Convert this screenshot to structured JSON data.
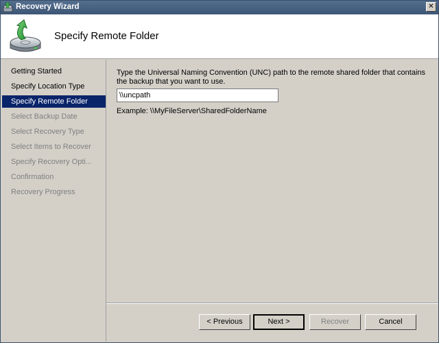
{
  "window": {
    "title": "Recovery Wizard",
    "close_glyph": "✕"
  },
  "header": {
    "heading": "Specify Remote Folder",
    "icon": "backup-recovery-icon"
  },
  "nav": {
    "items": [
      {
        "label": "Getting Started",
        "state": "enabled"
      },
      {
        "label": "Specify Location Type",
        "state": "enabled"
      },
      {
        "label": "Specify Remote Folder",
        "state": "selected"
      },
      {
        "label": "Select Backup Date",
        "state": "disabled"
      },
      {
        "label": "Select Recovery Type",
        "state": "disabled"
      },
      {
        "label": "Select Items to Recover",
        "state": "disabled"
      },
      {
        "label": "Specify Recovery Opti...",
        "state": "disabled"
      },
      {
        "label": "Confirmation",
        "state": "disabled"
      },
      {
        "label": "Recovery Progress",
        "state": "disabled"
      }
    ]
  },
  "content": {
    "instructions": "Type the Universal Naming Convention (UNC) path to the remote shared folder that contains the backup that you want to use.",
    "path_value": "\\\\uncpath",
    "example": "Example: \\\\MyFileServer\\SharedFolderName"
  },
  "buttons": {
    "previous": "< Previous",
    "next": "Next >",
    "recover": "Recover",
    "cancel": "Cancel"
  },
  "colors": {
    "title_bar": "#3d5675",
    "selection": "#0a246a",
    "dialog_face": "#d4d0c8"
  }
}
